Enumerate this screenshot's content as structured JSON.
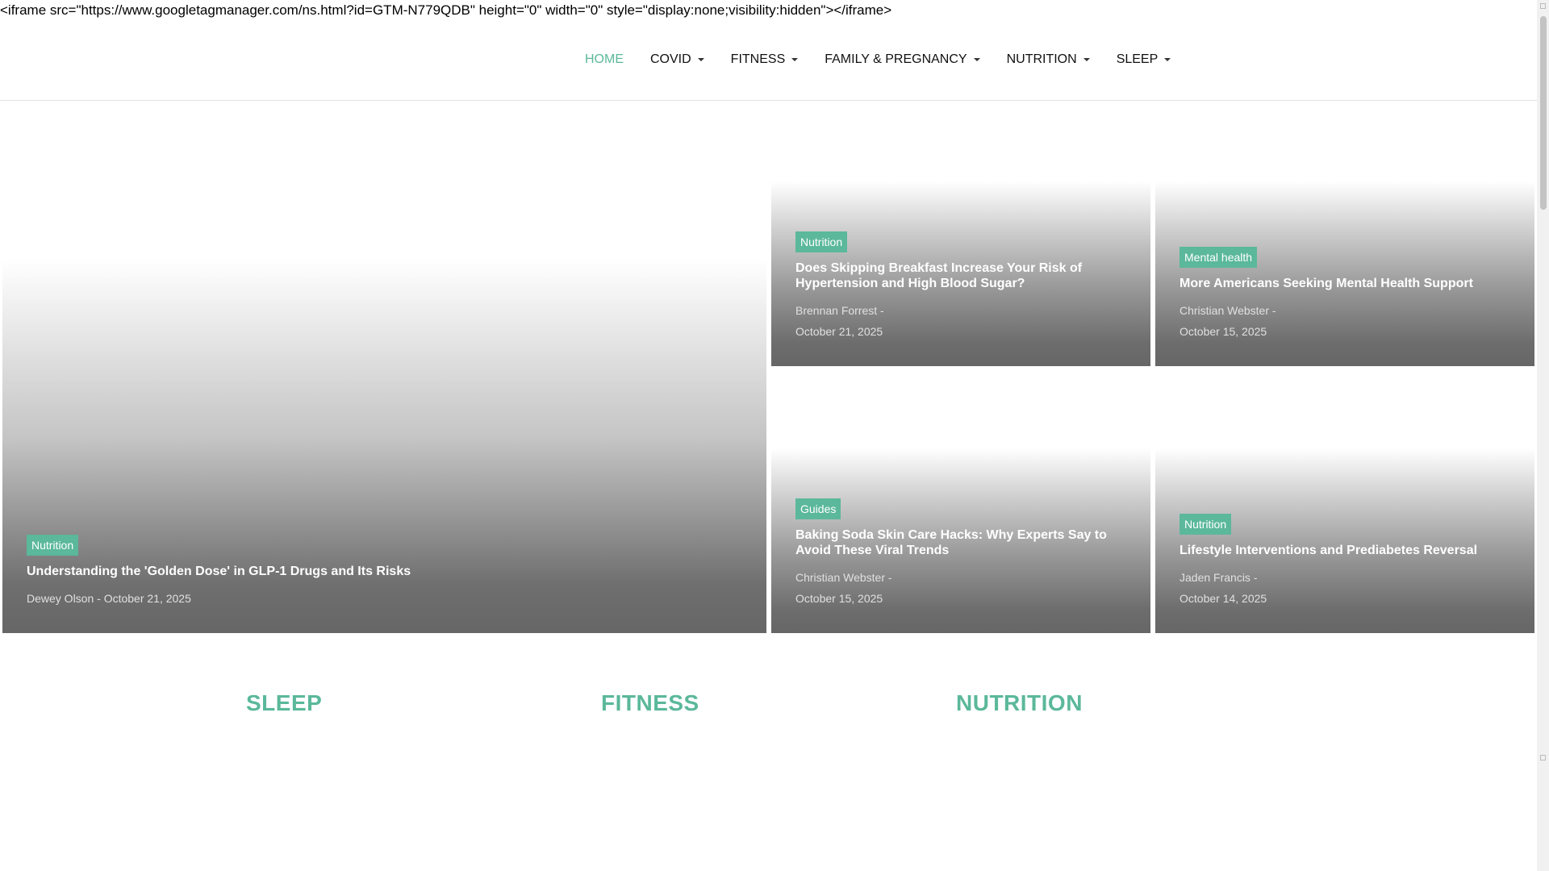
{
  "iframe_text": "<iframe src=\"https://www.googletagmanager.com/ns.html?id=GTM-N779QDB\" height=\"0\" width=\"0\" style=\"display:none;visibility:hidden\"></iframe>",
  "nav": {
    "items": [
      {
        "label": "HOME",
        "active": true,
        "dropdown": false
      },
      {
        "label": "COVID",
        "dropdown": true
      },
      {
        "label": "FITNESS",
        "dropdown": true
      },
      {
        "label": "FAMILY & PREGNANCY",
        "dropdown": true
      },
      {
        "label": "NUTRITION",
        "dropdown": true
      },
      {
        "label": "SLEEP",
        "dropdown": true
      }
    ]
  },
  "featured": {
    "main": {
      "category": "Nutrition",
      "title": "Understanding the 'Golden Dose' in GLP-1 Drugs and Its Risks",
      "meta": "Dewey Olson - October 21, 2025"
    },
    "cards": [
      {
        "category": "Nutrition",
        "title": "Does Skipping Breakfast Increase Your Risk of Hypertension and High Blood Sugar?",
        "author": "Brennan Forrest -",
        "date": "October 21, 2025"
      },
      {
        "category": "Mental health",
        "title": "More Americans Seeking Mental Health Support",
        "author": "Christian Webster -",
        "date": "October 15, 2025"
      },
      {
        "category": "Guides",
        "title": "Baking Soda Skin Care Hacks: Why Experts Say to Avoid These Viral Trends",
        "author": "Christian Webster -",
        "date": "October 15, 2025"
      },
      {
        "category": "Nutrition",
        "title": "Lifestyle Interventions and Prediabetes Reversal",
        "author": "Jaden Francis -",
        "date": "October 14, 2025"
      }
    ]
  },
  "sections": [
    "SLEEP",
    "FITNESS",
    "NUTRITION"
  ],
  "colors": {
    "accent": "#5bb89a",
    "card_dark": "#666666"
  }
}
